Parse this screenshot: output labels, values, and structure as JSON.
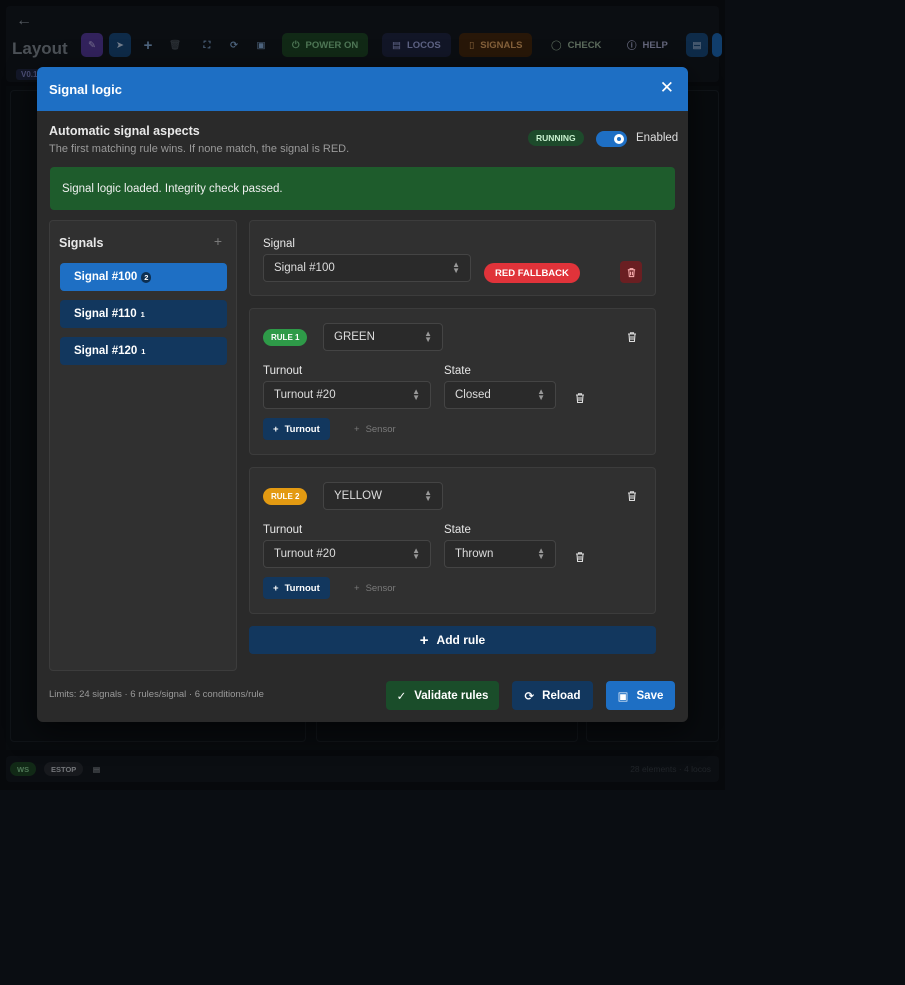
{
  "app": {
    "title": "Layout",
    "version": "V0.1",
    "toolbar": {
      "power_label": "POWER ON",
      "locos_label": "LOCOS",
      "signals_label": "SIGNALS",
      "check_label": "CHECK",
      "help_label": "HELP"
    },
    "status": {
      "ws": "WS",
      "estop": "ESTOP",
      "counts": "28 elements · 4 locos"
    }
  },
  "modal": {
    "title": "Signal logic",
    "heading": "Automatic signal aspects",
    "subheading": "The first matching rule wins. If none match, the signal is RED.",
    "running": "RUNNING",
    "enabled_label": "Enabled",
    "alert": "Signal logic loaded. Integrity check passed.",
    "signals_title": "Signals",
    "signals": [
      {
        "name": "Signal #100",
        "count": "2"
      },
      {
        "name": "Signal #110",
        "count": "1"
      },
      {
        "name": "Signal #120",
        "count": "1"
      }
    ],
    "signal_card": {
      "label": "Signal",
      "value": "Signal #100",
      "fallback": "RED FALLBACK"
    },
    "rules": [
      {
        "badge": "RULE 1",
        "aspect": "GREEN",
        "turnout_label": "Turnout",
        "turnout_value": "Turnout #20",
        "state_label": "State",
        "state_value": "Closed",
        "add_turnout": "Turnout",
        "add_sensor": "Sensor"
      },
      {
        "badge": "RULE 2",
        "aspect": "YELLOW",
        "turnout_label": "Turnout",
        "turnout_value": "Turnout #20",
        "state_label": "State",
        "state_value": "Thrown",
        "add_turnout": "Turnout",
        "add_sensor": "Sensor"
      }
    ],
    "add_rule": "Add rule",
    "limits": "Limits: 24 signals · 6 rules/signal · 6 conditions/rule",
    "validate": "Validate rules",
    "reload": "Reload",
    "save": "Save"
  },
  "colors": {
    "header": "#1e6fc4",
    "alert": "#1e5c2c",
    "rule1": "#2e9a48",
    "rule2": "#e39a12",
    "fallback": "#e0333a"
  }
}
